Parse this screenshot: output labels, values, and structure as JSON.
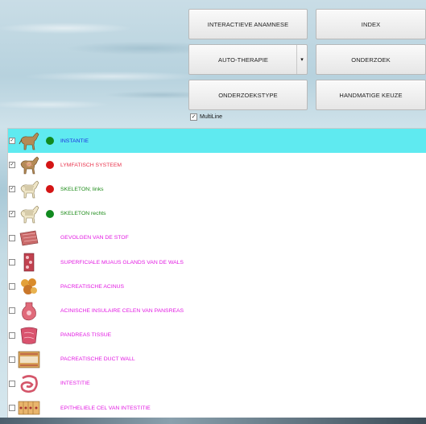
{
  "buttons": {
    "interactieve_anamnese": "INTERACTIEVE ANAMNESE",
    "index": "INDEX",
    "auto_therapie": "AUTO-THERAPIE",
    "auto_therapie_arrow": "▾",
    "onderzoek": "ONDERZOEK",
    "onderzoekstype": "ONDERZOEKSTYPE",
    "handmatige_keuze": "HANDMATIGE KEUZE"
  },
  "multiline": {
    "label": "MultiLine",
    "checked": true
  },
  "colors": {
    "selected_row": "#5feaf0",
    "dot_green": "#118a1f",
    "dot_red": "#d41515",
    "text_blue": "#1d2ce0",
    "text_red": "#e8324b",
    "text_green": "#1a8a16",
    "text_magenta": "#e21ae2"
  },
  "list": {
    "items": [
      {
        "label": "INSTANTIE",
        "checked": true,
        "dot": "green",
        "color": "#1d2ce0",
        "icon": "horse-icon",
        "selected": true
      },
      {
        "label": "LYMFATISCH SYSTEEM",
        "checked": true,
        "dot": "red",
        "color": "#e8324b",
        "icon": "horse-lymph-icon"
      },
      {
        "label": "SKELETON; links",
        "checked": true,
        "dot": "red",
        "color": "#1a8a16",
        "icon": "horse-skeleton-icon"
      },
      {
        "label": "SKELETON rechts",
        "checked": true,
        "dot": "green",
        "color": "#1a8a16",
        "icon": "horse-skeleton-icon"
      },
      {
        "label": "GEVOLGEN VAN DE STOF",
        "checked": false,
        "dot": "none",
        "color": "#e21ae2",
        "icon": "tissue-icon"
      },
      {
        "label": "SUPERFICIALE MUAUS GLANDS VAN DE WALS",
        "checked": false,
        "dot": "none",
        "color": "#e21ae2",
        "icon": "gland-tissue-icon"
      },
      {
        "label": "PACREATISCHE ACINUS",
        "checked": false,
        "dot": "none",
        "color": "#e21ae2",
        "icon": "acinus-icon"
      },
      {
        "label": "ACINISCHE INSULAIRE CELEN VAN PANSREAS",
        "checked": false,
        "dot": "none",
        "color": "#e21ae2",
        "icon": "pancreas-cell-icon"
      },
      {
        "label": "PANDREAS TISSUE",
        "checked": false,
        "dot": "none",
        "color": "#e21ae2",
        "icon": "pancreas-tissue-icon"
      },
      {
        "label": "PACREATISCHE DUCT WALL",
        "checked": false,
        "dot": "none",
        "color": "#e21ae2",
        "icon": "duct-wall-icon"
      },
      {
        "label": "INTESTITIE",
        "checked": false,
        "dot": "none",
        "color": "#e21ae2",
        "icon": "intestine-icon"
      },
      {
        "label": "EPITHELIELE CEL VAN INTESTITIE",
        "checked": false,
        "dot": "none",
        "color": "#e21ae2",
        "icon": "epithelial-cell-icon"
      }
    ]
  }
}
